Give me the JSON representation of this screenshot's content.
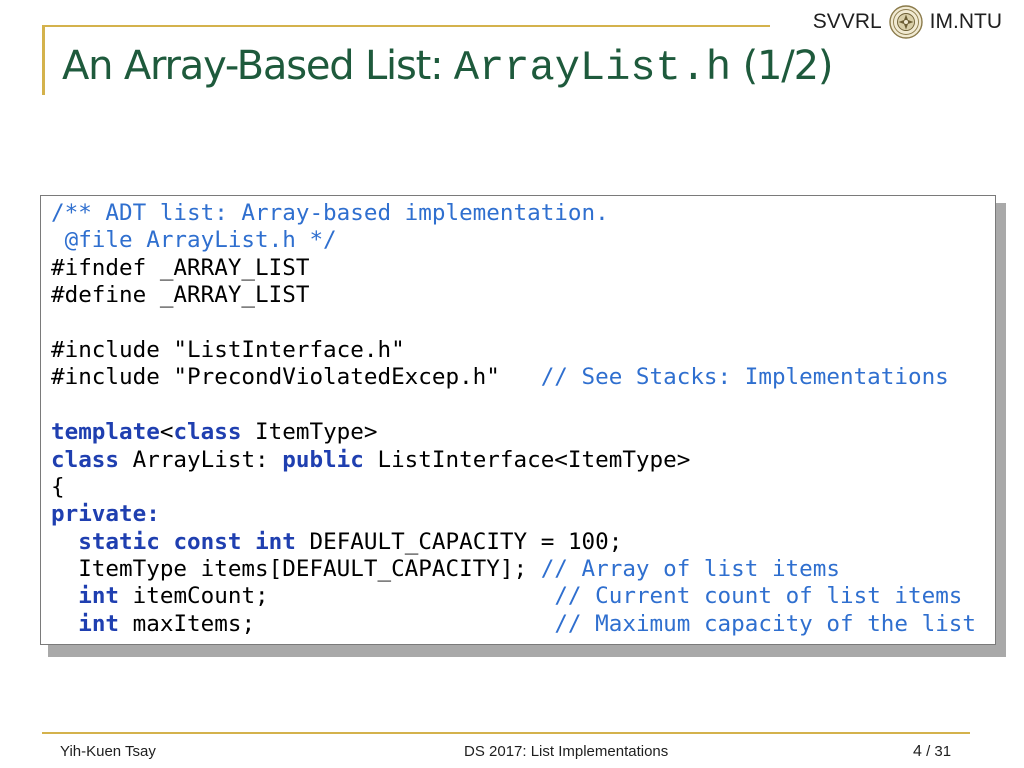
{
  "header": {
    "left_label": "SVVRL",
    "right_label": "IM.NTU",
    "seal_icon": "university-seal-icon"
  },
  "title": {
    "prefix": "An Array-Based List: ",
    "code": "ArrayList.h",
    "suffix": " (1/2)"
  },
  "code": {
    "lines": [
      [
        {
          "t": "/** ADT list: Array-based implementation.",
          "s": "cm"
        }
      ],
      [
        {
          "t": " @file ArrayList.h */",
          "s": "cm"
        }
      ],
      [
        {
          "t": "#ifndef _ARRAY_LIST",
          "s": ""
        }
      ],
      [
        {
          "t": "#define _ARRAY_LIST",
          "s": ""
        }
      ],
      [
        {
          "t": "",
          "s": ""
        }
      ],
      [
        {
          "t": "#include \"ListInterface.h\"",
          "s": ""
        }
      ],
      [
        {
          "t": "#include \"PrecondViolatedExcep.h\"   ",
          "s": ""
        },
        {
          "t": "// See Stacks: Implementations",
          "s": "cm"
        }
      ],
      [
        {
          "t": "",
          "s": ""
        }
      ],
      [
        {
          "t": "template",
          "s": "kw"
        },
        {
          "t": "<",
          "s": ""
        },
        {
          "t": "class",
          "s": "kw"
        },
        {
          "t": " ItemType>",
          "s": ""
        }
      ],
      [
        {
          "t": "class",
          "s": "kw"
        },
        {
          "t": " ArrayList: ",
          "s": ""
        },
        {
          "t": "public",
          "s": "kw"
        },
        {
          "t": " ListInterface<ItemType>",
          "s": ""
        }
      ],
      [
        {
          "t": "{",
          "s": ""
        }
      ],
      [
        {
          "t": "private:",
          "s": "kw"
        }
      ],
      [
        {
          "t": "  ",
          "s": ""
        },
        {
          "t": "static",
          "s": "kw"
        },
        {
          "t": " ",
          "s": ""
        },
        {
          "t": "const",
          "s": "kw"
        },
        {
          "t": " ",
          "s": ""
        },
        {
          "t": "int",
          "s": "kw"
        },
        {
          "t": " DEFAULT_CAPACITY = 100;",
          "s": ""
        }
      ],
      [
        {
          "t": "  ItemType items[DEFAULT_CAPACITY]; ",
          "s": ""
        },
        {
          "t": "// Array of list items",
          "s": "cm"
        }
      ],
      [
        {
          "t": "  ",
          "s": ""
        },
        {
          "t": "int",
          "s": "kw"
        },
        {
          "t": " itemCount;                     ",
          "s": ""
        },
        {
          "t": "// Current count of list items",
          "s": "cm"
        }
      ],
      [
        {
          "t": "  ",
          "s": ""
        },
        {
          "t": "int",
          "s": "kw"
        },
        {
          "t": " maxItems;                      ",
          "s": ""
        },
        {
          "t": "// Maximum capacity of the list",
          "s": "cm"
        }
      ]
    ]
  },
  "footer": {
    "author": "Yih-Kuen Tsay",
    "course": "DS 2017: List Implementations",
    "page_current": "4",
    "page_separator": " / ",
    "page_total": "31"
  },
  "colors": {
    "accent_line": "#d4b24c",
    "title": "#1e5a3c",
    "comment": "#2f6fcf",
    "keyword": "#1f3fb0"
  }
}
